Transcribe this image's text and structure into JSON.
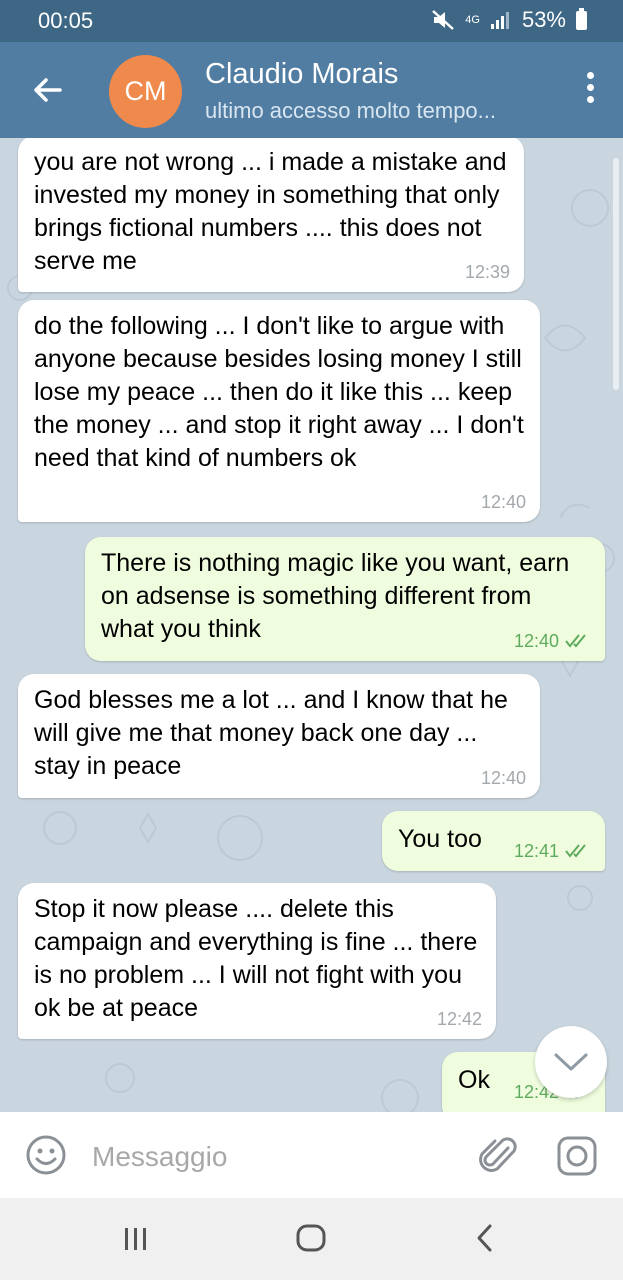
{
  "status_bar": {
    "time": "00:05",
    "network": "4G",
    "battery": "53%"
  },
  "header": {
    "avatar_initials": "CM",
    "avatar_color": "#f0894c",
    "contact_name": "Claudio Morais",
    "contact_status": "ultimo accesso molto tempo..."
  },
  "messages": [
    {
      "direction": "in",
      "text": "you are not wrong ... i made a mistake and invested my money in something that only brings fictional numbers .... this does not serve me",
      "time": "12:39"
    },
    {
      "direction": "in",
      "text": "do the following ... I don't like to argue with anyone because besides losing money I still lose my peace ... then do it like this ... keep the money ... and stop it right away ... I don't need that kind of numbers ok",
      "time": "12:40"
    },
    {
      "direction": "out",
      "text": "There is nothing magic like you want, earn on adsense is something different from what you think",
      "time": "12:40",
      "read": true
    },
    {
      "direction": "in",
      "text": "God blesses me a lot ... and I know that he will give me that money back one day ... stay in peace",
      "time": "12:40"
    },
    {
      "direction": "out",
      "text": "You too",
      "time": "12:41",
      "read": true
    },
    {
      "direction": "in",
      "text": "Stop it now please .... delete this campaign and everything is fine ... there is no problem ... I will not fight with you ok be at peace",
      "time": "12:42"
    },
    {
      "direction": "out",
      "text": "Ok",
      "time": "12:42",
      "read": true
    }
  ],
  "input": {
    "placeholder": "Messaggio",
    "value": ""
  },
  "colors": {
    "status_bar": "#3d6785",
    "header": "#517da2",
    "incoming_bubble": "#ffffff",
    "outgoing_bubble": "#effdde",
    "read_check": "#5fab5e",
    "chat_background": "#cad6df"
  },
  "icons": [
    "back-arrow-icon",
    "menu-icon",
    "mute-icon",
    "signal-icon",
    "battery-icon",
    "double-check-icon",
    "chevron-down-icon",
    "emoji-icon",
    "attach-icon",
    "camera-icon",
    "nav-recent-icon",
    "nav-home-icon",
    "nav-back-icon"
  ]
}
